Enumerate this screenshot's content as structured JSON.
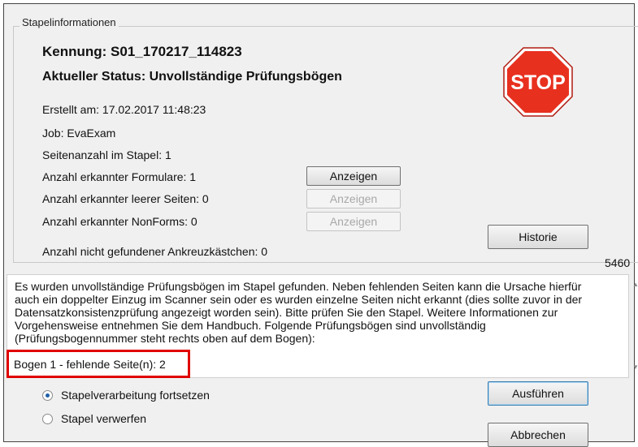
{
  "groupbox": {
    "title": "Stapelinformationen"
  },
  "info": {
    "kennung": "Kennung: S01_170217_114823",
    "status": "Aktueller Status: Unvollständige Prüfungsbögen",
    "erstellt": "Erstellt am: 17.02.2017 11:48:23",
    "job": "Job: EvaExam",
    "seitenanzahl": "Seitenanzahl im Stapel: 1",
    "formulare": "Anzahl erkannter Formulare: 1",
    "leere_seiten": "Anzahl erkannter leerer Seiten: 0",
    "nonforms": "Anzahl erkannter NonForms: 0",
    "ankreuz": "Anzahl nicht gefundener Ankreuzkästchen: 0",
    "number": "5460"
  },
  "buttons": {
    "anzeigen_1": "Anzeigen",
    "anzeigen_2": "Anzeigen",
    "anzeigen_3": "Anzeigen",
    "historie": "Historie",
    "ausfuehren": "Ausführen",
    "abbrechen": "Abbrechen"
  },
  "stop_sign": {
    "text": "STOP",
    "color": "#e8301f"
  },
  "message": {
    "text": "Es wurden unvollständige Prüfungsbögen im Stapel gefunden. Neben fehlenden Seiten kann die Ursache hierfür\nauch ein doppelter Einzug im Scanner sein oder es wurden einzelne Seiten nicht erkannt (dies sollte zuvor in der\nDatensatzkonsistenzprüfung angezeigt worden sein). Bitte prüfen Sie den Stapel. Weitere Informationen zur\nVorgehensweise entnehmen Sie dem Handbuch. Folgende Prüfungsbögen sind unvollständig\n(Prüfungsbogennummer steht rechts oben auf dem Bogen):",
    "bogen": "Bogen 1 - fehlende Seite(n): 2",
    "highlight_color": "#e00000"
  },
  "options": {
    "fortsetzen": "Stapelverarbeitung fortsetzen",
    "verwerfen": "Stapel verwerfen",
    "selected": "fortsetzen"
  }
}
